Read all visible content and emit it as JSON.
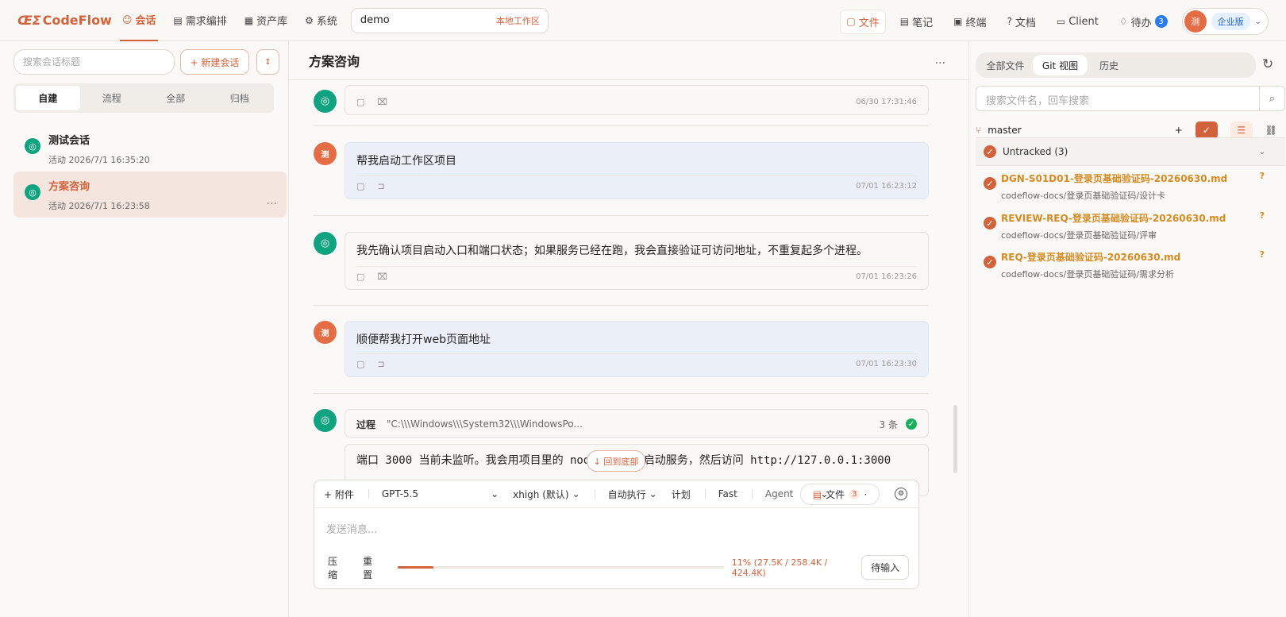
{
  "topbar": {
    "logo": "CodeFlow",
    "nav": [
      {
        "label": "会话",
        "icon": "chat-icon",
        "glyph": "☺"
      },
      {
        "label": "需求编排",
        "icon": "document-icon",
        "glyph": "▤"
      },
      {
        "label": "资产库",
        "icon": "assets-icon",
        "glyph": "▦"
      },
      {
        "label": "系统",
        "icon": "gear-icon",
        "glyph": "⚙"
      }
    ],
    "workspace": {
      "name": "demo",
      "tag": "本地工作区"
    },
    "right_items": [
      {
        "label": "文件",
        "icon": "folder-icon",
        "glyph": "▢"
      },
      {
        "label": "笔记",
        "icon": "note-icon",
        "glyph": "▤"
      },
      {
        "label": "终端",
        "icon": "terminal-icon",
        "glyph": "▣"
      },
      {
        "label": "文档",
        "icon": "help-icon",
        "glyph": "?"
      },
      {
        "label": "Client",
        "icon": "monitor-icon",
        "glyph": "▭"
      },
      {
        "label": "待办",
        "icon": "bell-icon",
        "glyph": "♢",
        "badge": "3"
      }
    ],
    "avatar": "测",
    "plan": "企业版",
    "profile_chevron": "⌄"
  },
  "left": {
    "search_placeholder": "搜索会话标题",
    "new_session": "+ 新建会话",
    "sort_icon": "↕",
    "tabs": [
      "自建",
      "流程",
      "全部",
      "归档"
    ],
    "sessions": [
      {
        "title": "测试会话",
        "meta": "活动 2026/7/1 16:35:20"
      },
      {
        "title": "方案咨询",
        "meta": "活动 2026/7/1 16:23:58"
      }
    ],
    "more": "..."
  },
  "chat": {
    "title": "方案咨询",
    "header_more": "...",
    "messages": [
      {
        "text": "",
        "time": "06/30 17:31:46",
        "tool1": "▢",
        "tool2": "⌧"
      },
      {
        "text": "帮我启动工作区项目",
        "time": "07/01 16:23:12",
        "tool1": "▢",
        "tool2": "⊐"
      },
      {
        "text": "我先确认项目启动入口和端口状态；如果服务已经在跑，我会直接验证可访问地址，不重复起多个进程。",
        "time": "07/01 16:23:26",
        "tool1": "▢",
        "tool2": "⌧"
      },
      {
        "text": "顺便帮我打开web页面地址",
        "time": "07/01 16:23:30",
        "tool1": "▢",
        "tool2": "⊐"
      }
    ],
    "process": {
      "label": "过程",
      "path": "\"C:\\\\\\Windows\\\\\\System32\\\\\\WindowsPo...",
      "count": "3 条",
      "status": "✓"
    },
    "code_line": "端口 3000 当前未监听。我会用项目里的 node tools 启动服务，然后访问 http://127.0.0.1:3000",
    "back_bottom": "↓ 回到底部",
    "composer": {
      "attach": "+ 附件",
      "model": "GPT-5.5",
      "reasoning": "xhigh (默认)",
      "execute": "自动执行",
      "plan": "计划",
      "fast": "Fast",
      "agent": "Agent",
      "file_chip": "文件",
      "file_count": "3",
      "placeholder": "发送消息...",
      "compress": "压缩",
      "reset": "重置",
      "usage": "11% (27.5K / 258.4K / 424.4K)",
      "usage_fraction": 0.11,
      "wait": "待输入"
    }
  },
  "right": {
    "tabs": [
      "全部文件",
      "Git 视图",
      "历史"
    ],
    "refresh_icon": "↻",
    "search_placeholder": "搜索文件名，回车搜索",
    "branch": "master",
    "group": "Untracked (3)",
    "files": [
      {
        "name": "DGN-S01D01-登录页基础验证码-20260630.md",
        "path": "codeflow-docs/登录页基础验证码/设计卡"
      },
      {
        "name": "REVIEW-REQ-登录页基础验证码-20260630.md",
        "path": "codeflow-docs/登录页基础验证码/评审"
      },
      {
        "name": "REQ-登录页基础验证码-20260630.md",
        "path": "codeflow-docs/登录页基础验证码/需求分析"
      }
    ]
  },
  "colors": {
    "accent": "#d2623c",
    "openai_green": "#10a37f",
    "badge_blue": "#2b7bf5"
  }
}
